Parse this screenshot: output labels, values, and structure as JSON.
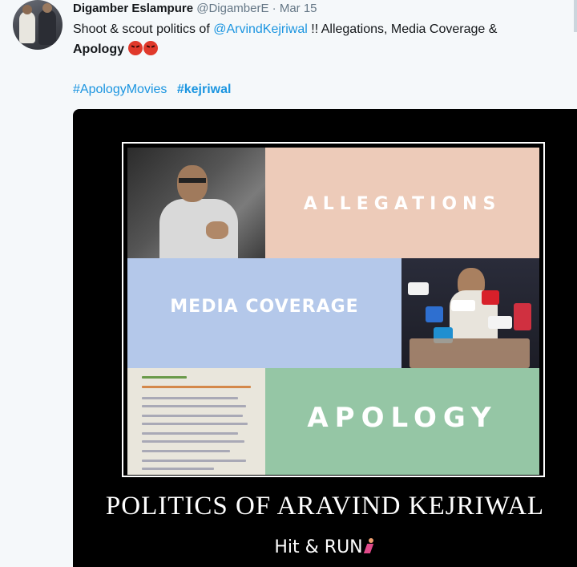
{
  "tweet": {
    "author_name": "Digamber Eslampure",
    "author_handle": "@DigamberE",
    "separator": "·",
    "date": "Mar 15",
    "text_part1": "Shoot & scout politics of ",
    "mention": "@ArvindKejriwal",
    "text_part2": "  !! Allegations, Media Coverage &",
    "text_bold": "Apology",
    "hashtags": [
      "#ApologyMovies",
      "#kejriwal"
    ]
  },
  "media": {
    "tiles": {
      "allegations": "ALLEGATIONS",
      "media_coverage": "MEDIA COVERAGE",
      "apology": "APOLOGY"
    },
    "caption": "POLITICS OF ARAVIND KEJRIWAL",
    "subcaption": "Hit  &  RUN"
  },
  "colors": {
    "link": "#1b95e0",
    "allegations_tile": "#edcbb9",
    "media_tile": "#b4c8ea",
    "apology_tile": "#95c6a5"
  },
  "icons": [
    "angry-emoji-icon",
    "runner-emoji-icon"
  ]
}
